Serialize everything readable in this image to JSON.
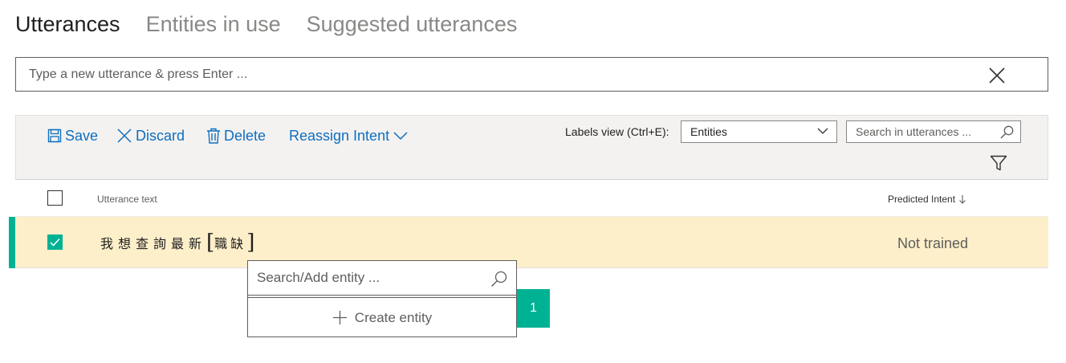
{
  "tabs": [
    {
      "label": "Utterances",
      "active": true
    },
    {
      "label": "Entities in use",
      "active": false
    },
    {
      "label": "Suggested utterances",
      "active": false
    }
  ],
  "utterance_input": {
    "placeholder": "Type a new utterance & press Enter ...",
    "value": ""
  },
  "toolbar": {
    "save_label": "Save",
    "discard_label": "Discard",
    "delete_label": "Delete",
    "reassign_label": "Reassign Intent",
    "labels_view_label": "Labels view (Ctrl+E):",
    "labels_view_value": "Entities",
    "search_placeholder": "Search in utterances ..."
  },
  "table": {
    "columns": {
      "utterance_text": "Utterance text",
      "predicted_intent": "Predicted Intent"
    },
    "rows": [
      {
        "selected": true,
        "text_before": "我想查詢最新",
        "entity_open_bracket": "[",
        "entity_text": "職缺",
        "entity_close_bracket": "]",
        "predicted_intent": "Not trained"
      }
    ]
  },
  "entity_popup": {
    "search_placeholder": "Search/Add entity ...",
    "create_label": "Create entity"
  },
  "step_badge": "1",
  "colors": {
    "accent": "#00b294",
    "link": "#106ebe",
    "selected_row": "#fdefca",
    "toolbar_bg": "#f3f2f1"
  },
  "icons": [
    "save-icon",
    "close-icon",
    "trash-icon",
    "chevron-down-icon",
    "search-icon",
    "filter-icon",
    "sort-down-arrow-icon",
    "checkmark-icon",
    "plus-icon"
  ]
}
